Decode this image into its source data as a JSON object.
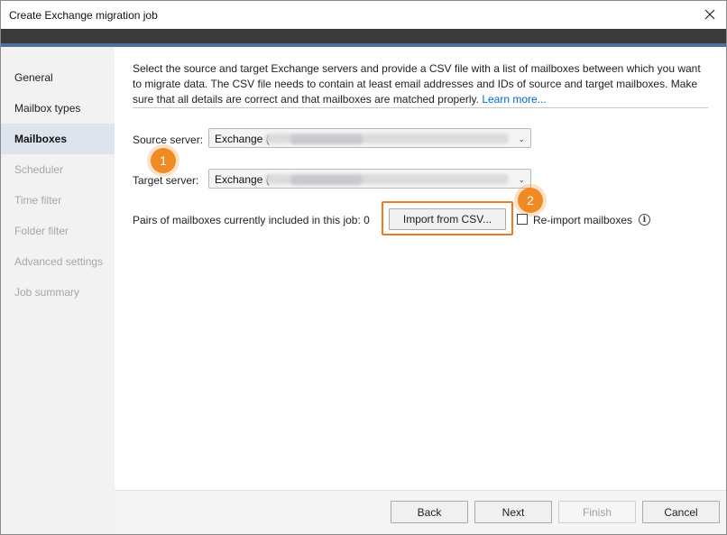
{
  "window": {
    "title": "Create Exchange migration job",
    "close_icon": "×"
  },
  "sidebar": {
    "items": [
      {
        "label": "General",
        "state": "enabled"
      },
      {
        "label": "Mailbox types",
        "state": "enabled"
      },
      {
        "label": "Mailboxes",
        "state": "active"
      },
      {
        "label": "Scheduler",
        "state": "disabled"
      },
      {
        "label": "Time filter",
        "state": "disabled"
      },
      {
        "label": "Folder filter",
        "state": "disabled"
      },
      {
        "label": "Advanced settings",
        "state": "disabled"
      },
      {
        "label": "Job summary",
        "state": "disabled"
      }
    ]
  },
  "main": {
    "description": "Select the source and target Exchange servers and provide a CSV file with a list of mailboxes between which you want to migrate data. The CSV file needs to contain at least email addresses and IDs of source and target mailboxes. Make sure that all details are correct and that mailboxes are matched properly.",
    "learn_more": "Learn more...",
    "source_label": "Source server:",
    "source_value": "Exchange (",
    "target_label": "Target server:",
    "target_value": "Exchange (",
    "pairs_label": "Pairs of mailboxes currently included in this job: 0",
    "import_button": "Import from CSV...",
    "reimport_label": "Re-import mailboxes",
    "info_icon": "i",
    "badge_1": "1",
    "badge_2": "2"
  },
  "footer": {
    "back": "Back",
    "next": "Next",
    "finish": "Finish",
    "cancel": "Cancel"
  },
  "colors": {
    "accent": "#f08a23",
    "banner": "#3b3b3b",
    "banner_stripe": "#4f6f9b",
    "link": "#0066cc",
    "active_nav": "#dde4ee"
  }
}
